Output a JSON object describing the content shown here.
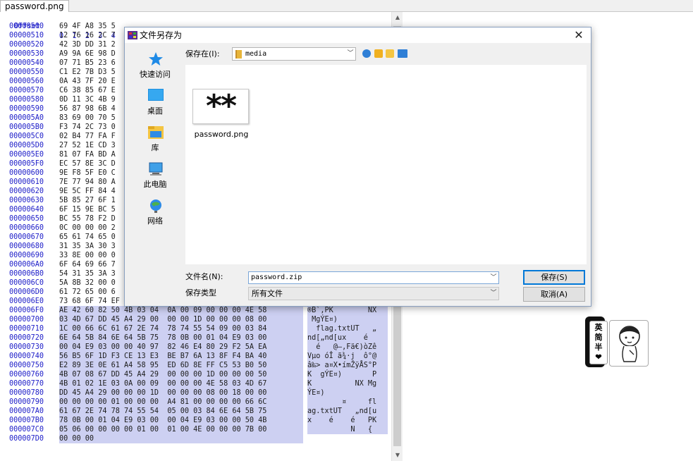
{
  "tab": {
    "title": "password.png"
  },
  "hex": {
    "header_offset": "Offset",
    "header_columns": "0  1  2  3  4  5  6  7   8  9  A  B  C  D  E  F",
    "rows": [
      {
        "offset": "00000500",
        "hex": "69 4F A8 35 5",
        "ascii": "",
        "sel": false
      },
      {
        "offset": "00000510",
        "hex": "12 76 16 2C 7",
        "ascii": "",
        "sel": false
      },
      {
        "offset": "00000520",
        "hex": "42 3D DD 31 2",
        "ascii": "",
        "sel": false
      },
      {
        "offset": "00000530",
        "hex": "A9 9A 6E 98 D",
        "ascii": "",
        "sel": false
      },
      {
        "offset": "00000540",
        "hex": "07 71 B5 23 6",
        "ascii": "",
        "sel": false
      },
      {
        "offset": "00000550",
        "hex": "C1 E2 7B D3 5",
        "ascii": "",
        "sel": false
      },
      {
        "offset": "00000560",
        "hex": "0A 43 7F 20 E",
        "ascii": "",
        "sel": false
      },
      {
        "offset": "00000570",
        "hex": "C6 38 85 67 E",
        "ascii": "",
        "sel": false
      },
      {
        "offset": "00000580",
        "hex": "0D 11 3C 4B 9",
        "ascii": "",
        "sel": false
      },
      {
        "offset": "00000590",
        "hex": "56 87 98 6B 4",
        "ascii": "",
        "sel": false
      },
      {
        "offset": "000005A0",
        "hex": "83 69 00 70 5",
        "ascii": "",
        "sel": false
      },
      {
        "offset": "000005B0",
        "hex": "F3 74 2C 73 0",
        "ascii": "",
        "sel": false
      },
      {
        "offset": "000005C0",
        "hex": "02 B4 77 FA F",
        "ascii": "",
        "sel": false
      },
      {
        "offset": "000005D0",
        "hex": "27 52 1E CD 3",
        "ascii": "",
        "sel": false
      },
      {
        "offset": "000005E0",
        "hex": "81 07 FA BD A",
        "ascii": "",
        "sel": false
      },
      {
        "offset": "000005F0",
        "hex": "EC 57 8E 3C D",
        "ascii": "",
        "sel": false
      },
      {
        "offset": "00000600",
        "hex": "9E F8 5F E0 C",
        "ascii": "",
        "sel": false
      },
      {
        "offset": "00000610",
        "hex": "7E 77 94 80 A",
        "ascii": "",
        "sel": false
      },
      {
        "offset": "00000620",
        "hex": "9E 5C FF 84 4",
        "ascii": "",
        "sel": false
      },
      {
        "offset": "00000630",
        "hex": "5B 85 27 6F 1",
        "ascii": "",
        "sel": false
      },
      {
        "offset": "00000640",
        "hex": "6F 15 9E BC 5",
        "ascii": "",
        "sel": false
      },
      {
        "offset": "00000650",
        "hex": "BC 55 78 F2 D",
        "ascii": "",
        "sel": false
      },
      {
        "offset": "00000660",
        "hex": "0C 00 00 00 2",
        "ascii": "",
        "sel": false
      },
      {
        "offset": "00000670",
        "hex": "65 61 74 65 0",
        "ascii": "",
        "sel": false
      },
      {
        "offset": "00000680",
        "hex": "31 35 3A 30 3",
        "ascii": "",
        "sel": false
      },
      {
        "offset": "00000690",
        "hex": "33 8E 00 00 0",
        "ascii": "",
        "sel": false
      },
      {
        "offset": "000006A0",
        "hex": "6F 64 69 66 7",
        "ascii": "",
        "sel": false
      },
      {
        "offset": "000006B0",
        "hex": "54 31 35 3A 3",
        "ascii": "",
        "sel": false
      },
      {
        "offset": "000006C0",
        "hex": "5A 8B 32 00 0",
        "ascii": "",
        "sel": false
      },
      {
        "offset": "000006D0",
        "hex": "61 72 65 00 6",
        "ascii": "",
        "sel": false
      },
      {
        "offset": "000006E0",
        "hex": "73 68 6F 74 EF 03 BF 3E  00 00 00 00 49 45 4E 44",
        "ascii": "shotï ¿>     IEND",
        "sel": false,
        "split": true
      },
      {
        "offset": "000006F0",
        "hex": "AE 42 60 82 50 4B 03 04  0A 00 09 00 00 00 4E 58",
        "ascii": "®B`,PK        NX",
        "sel": true
      },
      {
        "offset": "00000700",
        "hex": "03 4D 67 DD 45 A4 29 00  00 00 1D 00 00 00 08 00",
        "ascii": " MgÝE¤)         ",
        "sel": true
      },
      {
        "offset": "00000710",
        "hex": "1C 00 66 6C 61 67 2E 74  78 74 55 54 09 00 03 84",
        "ascii": "  flag.txtUT   „",
        "sel": true
      },
      {
        "offset": "00000720",
        "hex": "6E 64 5B 84 6E 64 5B 75  78 0B 00 01 04 E9 03 00",
        "ascii": "nd[„nd[ux    é  ",
        "sel": true
      },
      {
        "offset": "00000730",
        "hex": "00 04 E9 03 00 00 40 97  82 46 E4 80 29 F2 5A EA",
        "ascii": "  é   @—‚Fä€)òZê",
        "sel": true
      },
      {
        "offset": "00000740",
        "hex": "56 B5 6F 1D F3 CE 13 E3  BE B7 6A 13 8F F4 BA 40",
        "ascii": "Vµo óÎ ã¾·j  ô°@",
        "sel": true
      },
      {
        "offset": "00000750",
        "hex": "E2 89 3E 0E 61 A4 58 95  ED 6D 8E FF C5 53 B0 50",
        "ascii": "â‰> a¤X•ímŽÿÅS°P",
        "sel": true
      },
      {
        "offset": "00000760",
        "hex": "4B 07 08 67 DD 45 A4 29  00 00 00 1D 00 00 00 50",
        "ascii": "K  gÝE¤)       P",
        "sel": true
      },
      {
        "offset": "00000770",
        "hex": "4B 01 02 1E 03 0A 00 09  00 00 00 4E 58 03 4D 67",
        "ascii": "K          NX Mg",
        "sel": true
      },
      {
        "offset": "00000780",
        "hex": "DD 45 A4 29 00 00 00 1D  00 00 00 08 00 18 00 00",
        "ascii": "ÝE¤)            ",
        "sel": true
      },
      {
        "offset": "00000790",
        "hex": "00 00 00 00 01 00 00 00  A4 81 00 00 00 00 66 6C",
        "ascii": "        ¤     fl",
        "sel": true
      },
      {
        "offset": "000007A0",
        "hex": "61 67 2E 74 78 74 55 54  05 00 03 84 6E 64 5B 75",
        "ascii": "ag.txtUT   „nd[u",
        "sel": true
      },
      {
        "offset": "000007B0",
        "hex": "78 0B 00 01 04 E9 03 00  00 04 E9 03 00 00 50 4B",
        "ascii": "x    é    é   PK",
        "sel": true
      },
      {
        "offset": "000007C0",
        "hex": "05 06 00 00 00 00 01 00  01 00 4E 00 00 00 7B 00",
        "ascii": "          N   { ",
        "sel": true
      },
      {
        "offset": "000007D0",
        "hex": "00 00 00",
        "ascii": "",
        "sel": true
      }
    ]
  },
  "dialog": {
    "title": "文件另存为",
    "close": "✕",
    "places": [
      {
        "label": "快速访问",
        "icon": "star-icon"
      },
      {
        "label": "桌面",
        "icon": "desktop-icon"
      },
      {
        "label": "库",
        "icon": "library-icon"
      },
      {
        "label": "此电脑",
        "icon": "computer-icon"
      },
      {
        "label": "网络",
        "icon": "network-icon"
      }
    ],
    "save_in_label": "保存在(I):",
    "save_in_value": "media",
    "file": {
      "name": "password.png",
      "thumb": "**"
    },
    "filename_label": "文件名(N):",
    "filename_value": "password.zip",
    "filetype_label": "保存类型",
    "filetype_value": "所有文件",
    "save_button": "保存(S)",
    "cancel_button": "取消(A)"
  },
  "sticker": {
    "badge_text": "英\n简\n半\n❤"
  },
  "colors": {
    "offset_blue": "#1c1cc8",
    "selection": "#cdd0f2",
    "accent": "#0078d7"
  }
}
